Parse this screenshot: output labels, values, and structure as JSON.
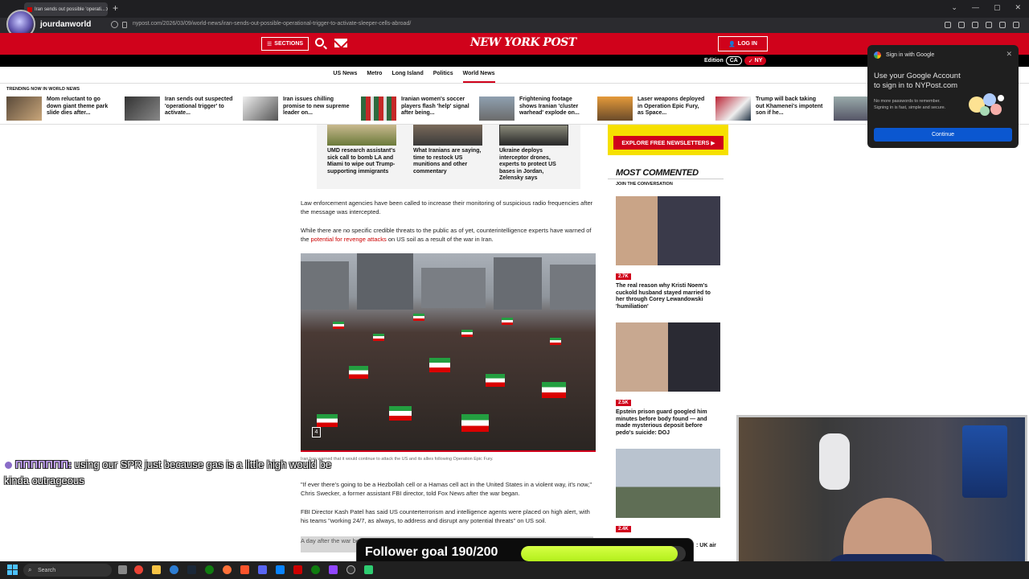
{
  "browser": {
    "tab_title": "Iran sends out possible 'operati...",
    "url": "nypost.com/2026/03/09/world-news/iran-sends-out-possible-operational-trigger-to-activate-sleeper-cells-abroad/"
  },
  "stream": {
    "channel_name": "jourdanworld",
    "chat_user": "ΠΠΠΠΠΠΠ:",
    "chat_message": " using our SPR just because gas is a little high would be kinda outrageous",
    "goal_label": "Follower goal 190/200",
    "goal_progress": 0.95
  },
  "site": {
    "logo": "NEW YORK POST",
    "sections_label": "SECTIONS",
    "login_label": "LOG IN",
    "edition_label": "Edition",
    "editions": [
      "CA",
      "NY"
    ],
    "edition_selected": "NY",
    "nav": [
      "US News",
      "Metro",
      "Long Island",
      "Politics",
      "World News"
    ],
    "nav_active": "World News"
  },
  "trending": {
    "label": "TRENDING NOW IN WORLD NEWS",
    "items": [
      "Mom reluctant to go down giant theme park slide dies after...",
      "Iran sends out suspected 'operational trigger' to activate...",
      "Iran issues chilling promise to new supreme leader on...",
      "Iranian women's soccer players flash 'help' signal after being...",
      "Frightening footage shows Iranian 'cluster warhead' explode on...",
      "Laser weapons deployed in Operation Epic Fury, as Space...",
      "Trump will back taking out Khamenei's impotent son if he..."
    ]
  },
  "article": {
    "related": [
      "UMD research assistant's sick call to bomb LA and Miami to wipe out Trump-supporting immigrants",
      "What Iranians are saying, time to restock US munitions and other commentary",
      "Ukraine deploys interceptor drones, experts to protect US bases in Jordan, Zelensky says"
    ],
    "p1": "Law enforcement agencies have been called to increase their monitoring of suspicious radio frequencies after the message was intercepted.",
    "p2_before": "While there are no specific credible threats to the public as of yet, counterintelligence experts have warned of the ",
    "p2_link": "potential for revenge attacks",
    "p2_after": " on US soil as a result of the war in Iran.",
    "photo_count": "4",
    "caption": "Iran has warned that it would continue to attack the US and its allies following Operation Epic Fury.",
    "p3": "\"If ever there's going to be a Hezbollah cell or a Hamas cell act in the United States in a violent way, it's now,\" Chris Swecker, a former assistant FBI director, told Fox News after the war began.",
    "p4": "FBI Director Kash Patel has said US counterterrorism and intelligence agents were placed on high alert, with his teams \"working 24/7, as always, to address and disrupt any potential threats\" on US soil.",
    "p5": "A day after the war began... people and injuring..."
  },
  "sidebar": {
    "newsletter_btn": "EXPLORE FREE NEWSLETTERS ▶",
    "most_commented": "MOST COMMENTED",
    "join": "JOIN THE CONVERSATION",
    "items": [
      {
        "badge": "2.7K",
        "text": "The real reason why Kristi Noem's cuckold husband stayed married to her through Corey Lewandowski 'humiliation'"
      },
      {
        "badge": "2.5K",
        "text": "Epstein prison guard googled him minutes before body found — and made mysterious deposit before pedo's suicide: DOJ"
      },
      {
        "badge": "2.4K",
        "text": ": UK air"
      }
    ]
  },
  "google_popup": {
    "header": "Sign in with Google",
    "title": "Use your Google Account to sign in to NYPost.com",
    "desc": "No more passwords to remember. Signing in is fast, simple and secure.",
    "button": "Continue"
  },
  "taskbar": {
    "search_label": "Search"
  }
}
